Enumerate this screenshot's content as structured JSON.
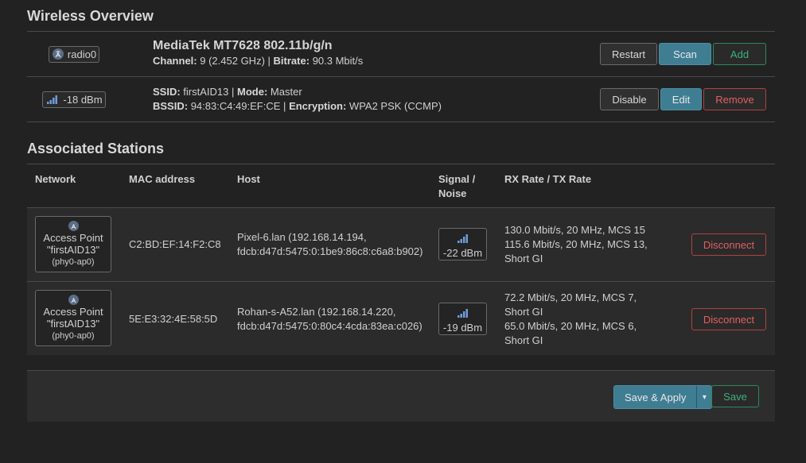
{
  "wireless": {
    "heading": "Wireless Overview",
    "device": {
      "badge_label": "radio0",
      "title": "MediaTek MT7628 802.11b/g/n",
      "channel_label": "Channel:",
      "channel_value": "9 (2.452 GHz)",
      "sep": "|",
      "bitrate_label": "Bitrate:",
      "bitrate_value": "90.3 Mbit/s",
      "buttons": {
        "restart": "Restart",
        "scan": "Scan",
        "add": "Add"
      }
    },
    "network": {
      "signal_label": "-18 dBm",
      "ssid_label": "SSID:",
      "ssid_value": "firstAID13",
      "sep": "|",
      "mode_label": "Mode:",
      "mode_value": "Master",
      "bssid_label": "BSSID:",
      "bssid_value": "94:83:C4:49:EF:CE",
      "enc_label": "Encryption:",
      "enc_value": "WPA2 PSK (CCMP)",
      "buttons": {
        "disable": "Disable",
        "edit": "Edit",
        "remove": "Remove"
      }
    }
  },
  "stations": {
    "heading": "Associated Stations",
    "columns": {
      "network": "Network",
      "mac": "MAC address",
      "host": "Host",
      "signal_l1": "Signal /",
      "signal_l2": "Noise",
      "rate": "RX Rate / TX Rate"
    },
    "rows": [
      {
        "ap_l1": "Access Point",
        "ap_l2": "\"firstAID13\"",
        "ap_l3": "(phy0-ap0)",
        "mac": "C2:BD:EF:14:F2:C8",
        "host_l1": "Pixel-6.lan (192.168.14.194,",
        "host_l2": "fdcb:d47d:5475:0:1be9:86c8:c6a8:b902)",
        "signal": "-22 dBm",
        "rate_l1": "130.0 Mbit/s, 20 MHz, MCS 15",
        "rate_l2": "115.6 Mbit/s, 20 MHz, MCS 13,",
        "rate_l3": "Short GI",
        "rate_l4": "",
        "disconnect": "Disconnect"
      },
      {
        "ap_l1": "Access Point",
        "ap_l2": "\"firstAID13\"",
        "ap_l3": "(phy0-ap0)",
        "mac": "5E:E3:32:4E:58:5D",
        "host_l1": "Rohan-s-A52.lan (192.168.14.220,",
        "host_l2": "fdcb:d47d:5475:0:80c4:4cda:83ea:c026)",
        "signal": "-19 dBm",
        "rate_l1": "72.2 Mbit/s, 20 MHz, MCS 7,",
        "rate_l2": "Short GI",
        "rate_l3": "65.0 Mbit/s, 20 MHz, MCS 6,",
        "rate_l4": "Short GI",
        "disconnect": "Disconnect"
      }
    ]
  },
  "footer": {
    "save_apply": "Save & Apply",
    "dropdown_glyph": "▾",
    "save": "Save"
  },
  "colors": {
    "primary": "#3f7d93",
    "positive": "#2d8a5c",
    "negative": "#b2413f",
    "signal_icon": "#6f9cd8"
  }
}
